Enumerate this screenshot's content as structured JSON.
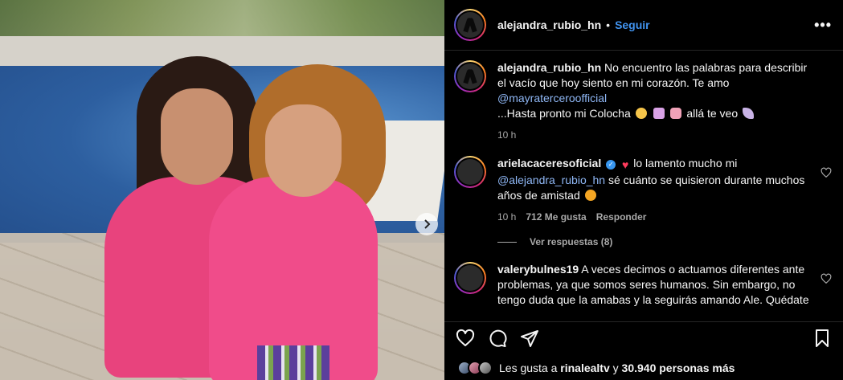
{
  "post": {
    "image_alt_hint": "",
    "next_icon": "chevron-right-icon"
  },
  "header": {
    "username": "alejandra_rubio_hn",
    "separator": "•",
    "follow_label": "Seguir",
    "more_icon": "•••"
  },
  "caption": {
    "username": "alejandra_rubio_hn",
    "text_1": "No encuentro las palabras para describir el vacío que hoy siento en mi corazón. Te amo",
    "mention": "@mayraterceroofficial",
    "text_2": "...Hasta pronto mi Colocha",
    "text_3": "allá te veo",
    "time": "10 h"
  },
  "comments": [
    {
      "username": "arielacaceresoficial",
      "text_1": "lo lamento mucho mi",
      "mention": "@alejandra_rubio_hn",
      "text_2": "sé cuánto se quisieron durante muchos años de amistad",
      "time": "10 h",
      "likes": "712 Me gusta",
      "reply_label": "Responder",
      "view_replies": "Ver respuestas (8)"
    },
    {
      "username": "valerybulnes19",
      "text_1": "A veces decimos o actuamos diferentes ante problemas, ya que somos seres humanos. Sin embargo, no tengo duda que la amabas y la seguirás amando Ale. Quédate",
      "text_2": ""
    }
  ],
  "likes_line": {
    "prefix": "Les gusta a",
    "user": "rinalealtv",
    "middle": "y",
    "count": "30.940 personas más"
  },
  "colors": {
    "background": "#000000",
    "text": "#f5f5f5",
    "secondary": "#a8a8a8",
    "link": "#4193ef",
    "mention": "#8fb7f5"
  }
}
